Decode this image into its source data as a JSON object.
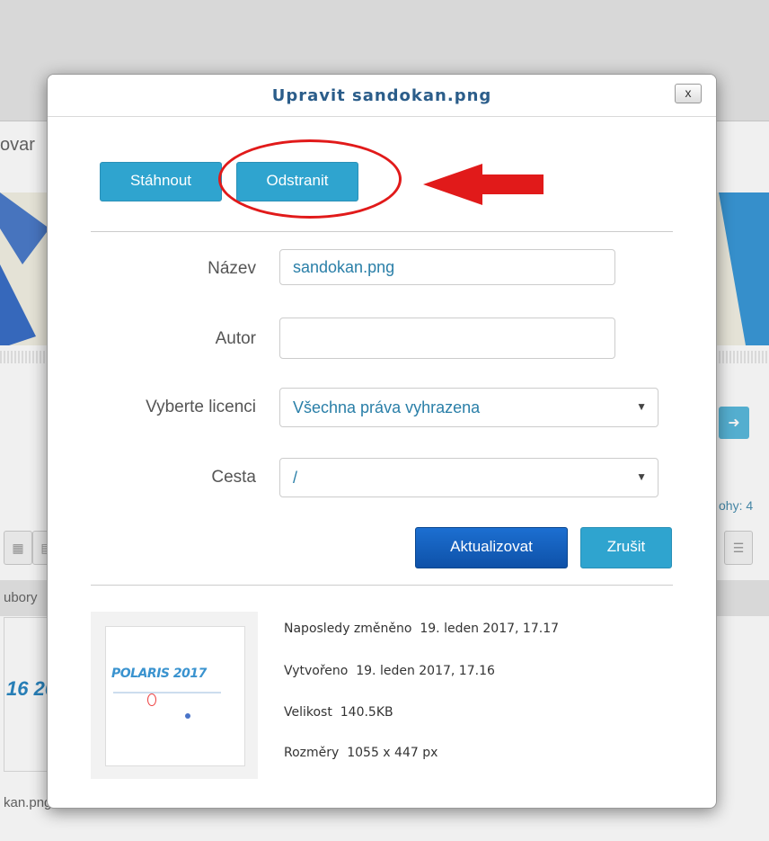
{
  "background": {
    "partial_heading": "ovar",
    "side_text": "ohy: 4",
    "partial_tab": "ubory",
    "partial_banner_text": "16 20",
    "partial_filename": "kan.png"
  },
  "modal": {
    "title": "Upravit sandokan.png",
    "close_label": "x",
    "buttons": {
      "download": "Stáhnout",
      "delete": "Odstranit",
      "update": "Aktualizovat",
      "cancel": "Zrušit"
    },
    "form": {
      "name_label": "Název",
      "name_value": "sandokan.png",
      "author_label": "Autor",
      "author_value": "",
      "license_label": "Vyberte licenci",
      "license_value": "Všechna práva vyhrazena",
      "path_label": "Cesta",
      "path_value": "/"
    },
    "preview": {
      "image_text": "POLARIS 2017"
    },
    "info": {
      "modified_label": "Naposledy změněno",
      "modified_value": "19. leden 2017, 17.17",
      "created_label": "Vytvořeno",
      "created_value": "19. leden 2017, 17.16",
      "size_label": "Velikost",
      "size_value": "140.5KB",
      "dimensions_label": "Rozměry",
      "dimensions_value": "1055 x 447 px"
    }
  },
  "colors": {
    "accent_info": "#2fa4cf",
    "accent_primary": "#1c6fd1",
    "annotation_red": "#e11a1a",
    "title_blue": "#2b5d8a"
  },
  "icons": {
    "close": "close-icon",
    "select_caret": "caret-down-icon",
    "annotation": "red-arrow-icon"
  }
}
